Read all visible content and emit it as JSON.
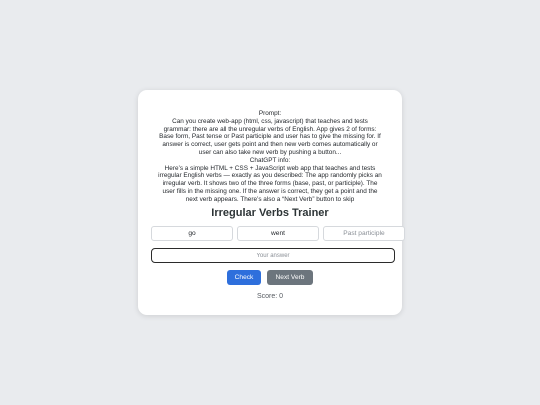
{
  "prompt_lines": [
    "Prompt:",
    "Can you create web-app (html, css, javascript) that teaches and tests",
    "grammar: there are all the unregular verbs of English. App gives 2 of forms:",
    "Base form, Past tense or Past participle and user has to give the missing for. If",
    "answer is correct, user gets point and then new verb comes automatically or",
    "user can also take new verb by pushing a button...",
    "ChatGPT info:",
    "Here’s a simple HTML + CSS + JavaScript web app that teaches and tests",
    "irregular English verbs — exactly as you described: The app randomly picks an",
    "irregular verb. It shows two of the three forms (base, past, or participle). The",
    "user fills in the missing one. If the answer is correct, they get a point and the",
    "next verb appears. There’s also a “Next Verb” button to skip"
  ],
  "trainer": {
    "title": "Irregular Verbs Trainer",
    "forms": {
      "base": "go",
      "past": "went",
      "participle_placeholder": "Past participle"
    },
    "answer_placeholder": "Your answer",
    "check_label": "Check",
    "next_label": "Next Verb",
    "score_text": "Score: 0"
  },
  "colors": {
    "check_button": "#2e6fdc",
    "next_button": "#6c757d",
    "background": "#e9ebee"
  }
}
